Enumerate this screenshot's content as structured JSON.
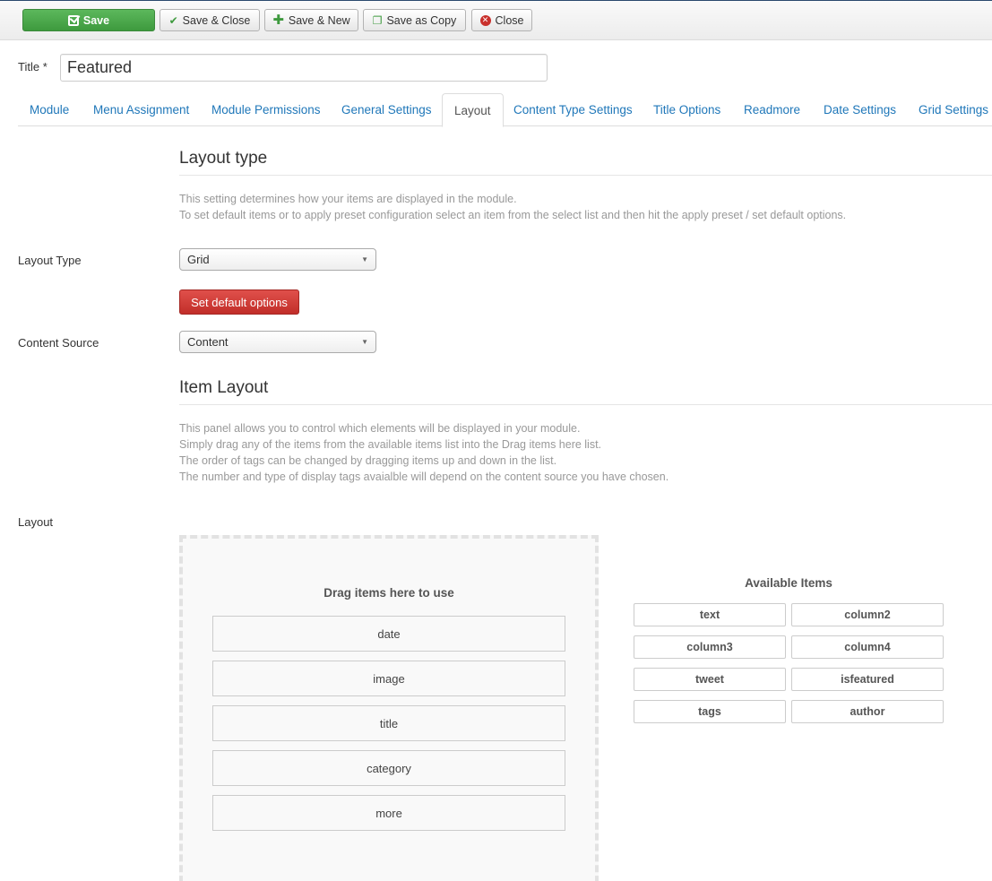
{
  "toolbar": {
    "save": "Save",
    "save_close": "Save & Close",
    "save_new": "Save & New",
    "save_copy": "Save as Copy",
    "close": "Close"
  },
  "title_field": {
    "label": "Title *",
    "value": "Featured"
  },
  "tabs": [
    {
      "label": "Module"
    },
    {
      "label": "Menu Assignment"
    },
    {
      "label": "Module Permissions"
    },
    {
      "label": "General Settings"
    },
    {
      "label": "Layout",
      "active": true
    },
    {
      "label": "Content Type Settings"
    },
    {
      "label": "Title Options"
    },
    {
      "label": "Readmore"
    },
    {
      "label": "Date Settings"
    },
    {
      "label": "Grid Settings"
    }
  ],
  "layout_type_section": {
    "heading": "Layout type",
    "desc_line1": "This setting determines how your items are displayed in the module.",
    "desc_line2": "To set default items or to apply preset configuration select an item from the select list and then hit the apply preset / set default options."
  },
  "layout_type": {
    "label": "Layout Type",
    "value": "Grid"
  },
  "set_default_button": "Set default options",
  "content_source": {
    "label": "Content Source",
    "value": "Content"
  },
  "item_layout_section": {
    "heading": "Item Layout",
    "desc_line1": "This panel allows you to control which elements will be displayed in your module.",
    "desc_line2": "Simply drag any of the items from the available items list into the Drag items here list.",
    "desc_line3": "The order of tags can be changed by dragging items up and down in the list.",
    "desc_line4": "The number and type of display tags avaialble will depend on the content source you have chosen."
  },
  "layout_label": "Layout",
  "dropzone": {
    "title": "Drag items here to use",
    "items": [
      "date",
      "image",
      "title",
      "category",
      "more"
    ]
  },
  "available": {
    "title": "Available Items",
    "items": [
      "text",
      "column2",
      "column3",
      "column4",
      "tweet",
      "isfeatured",
      "tags",
      "author"
    ]
  }
}
